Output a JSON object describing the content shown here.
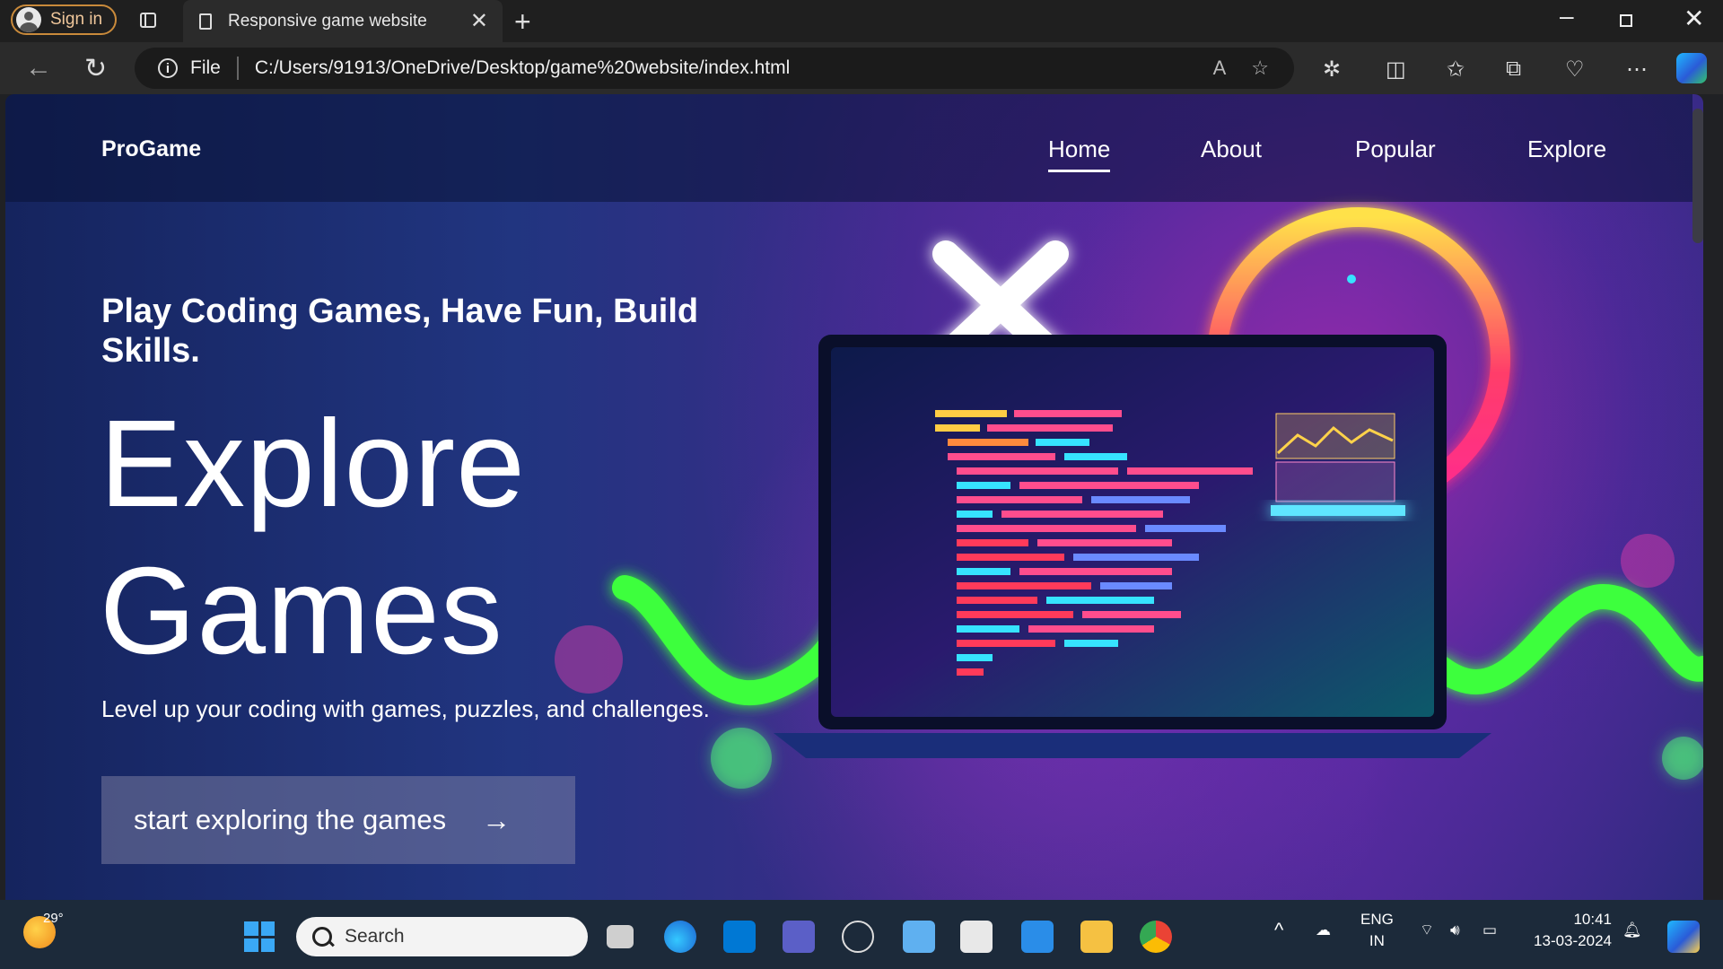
{
  "browser": {
    "signin_label": "Sign in",
    "tab_title": "Responsive game website",
    "address_prefix": "File",
    "url": "C:/Users/91913/OneDrive/Desktop/game%20website/index.html"
  },
  "site": {
    "logo": "ProGame",
    "nav": [
      "Home",
      "About",
      "Popular",
      "Explore"
    ],
    "active_nav": "Home",
    "tagline": "Play Coding Games, Have Fun, Build Skills.",
    "title_line1": "Explore",
    "title_line2": "Games",
    "lead": "Level up your coding with games, puzzles, and challenges.",
    "cta_label": "start exploring the games"
  },
  "taskbar": {
    "temperature": "29°",
    "search_placeholder": "Search",
    "lang_line1": "ENG",
    "lang_line2": "IN",
    "time": "10:41",
    "date": "13-03-2024"
  },
  "colors": {
    "accent_signin": "#c98a3b",
    "taskbar_bg": "#1c2a3a",
    "page_bg_left": "#15245e",
    "page_bg_right": "#4a2b94"
  }
}
